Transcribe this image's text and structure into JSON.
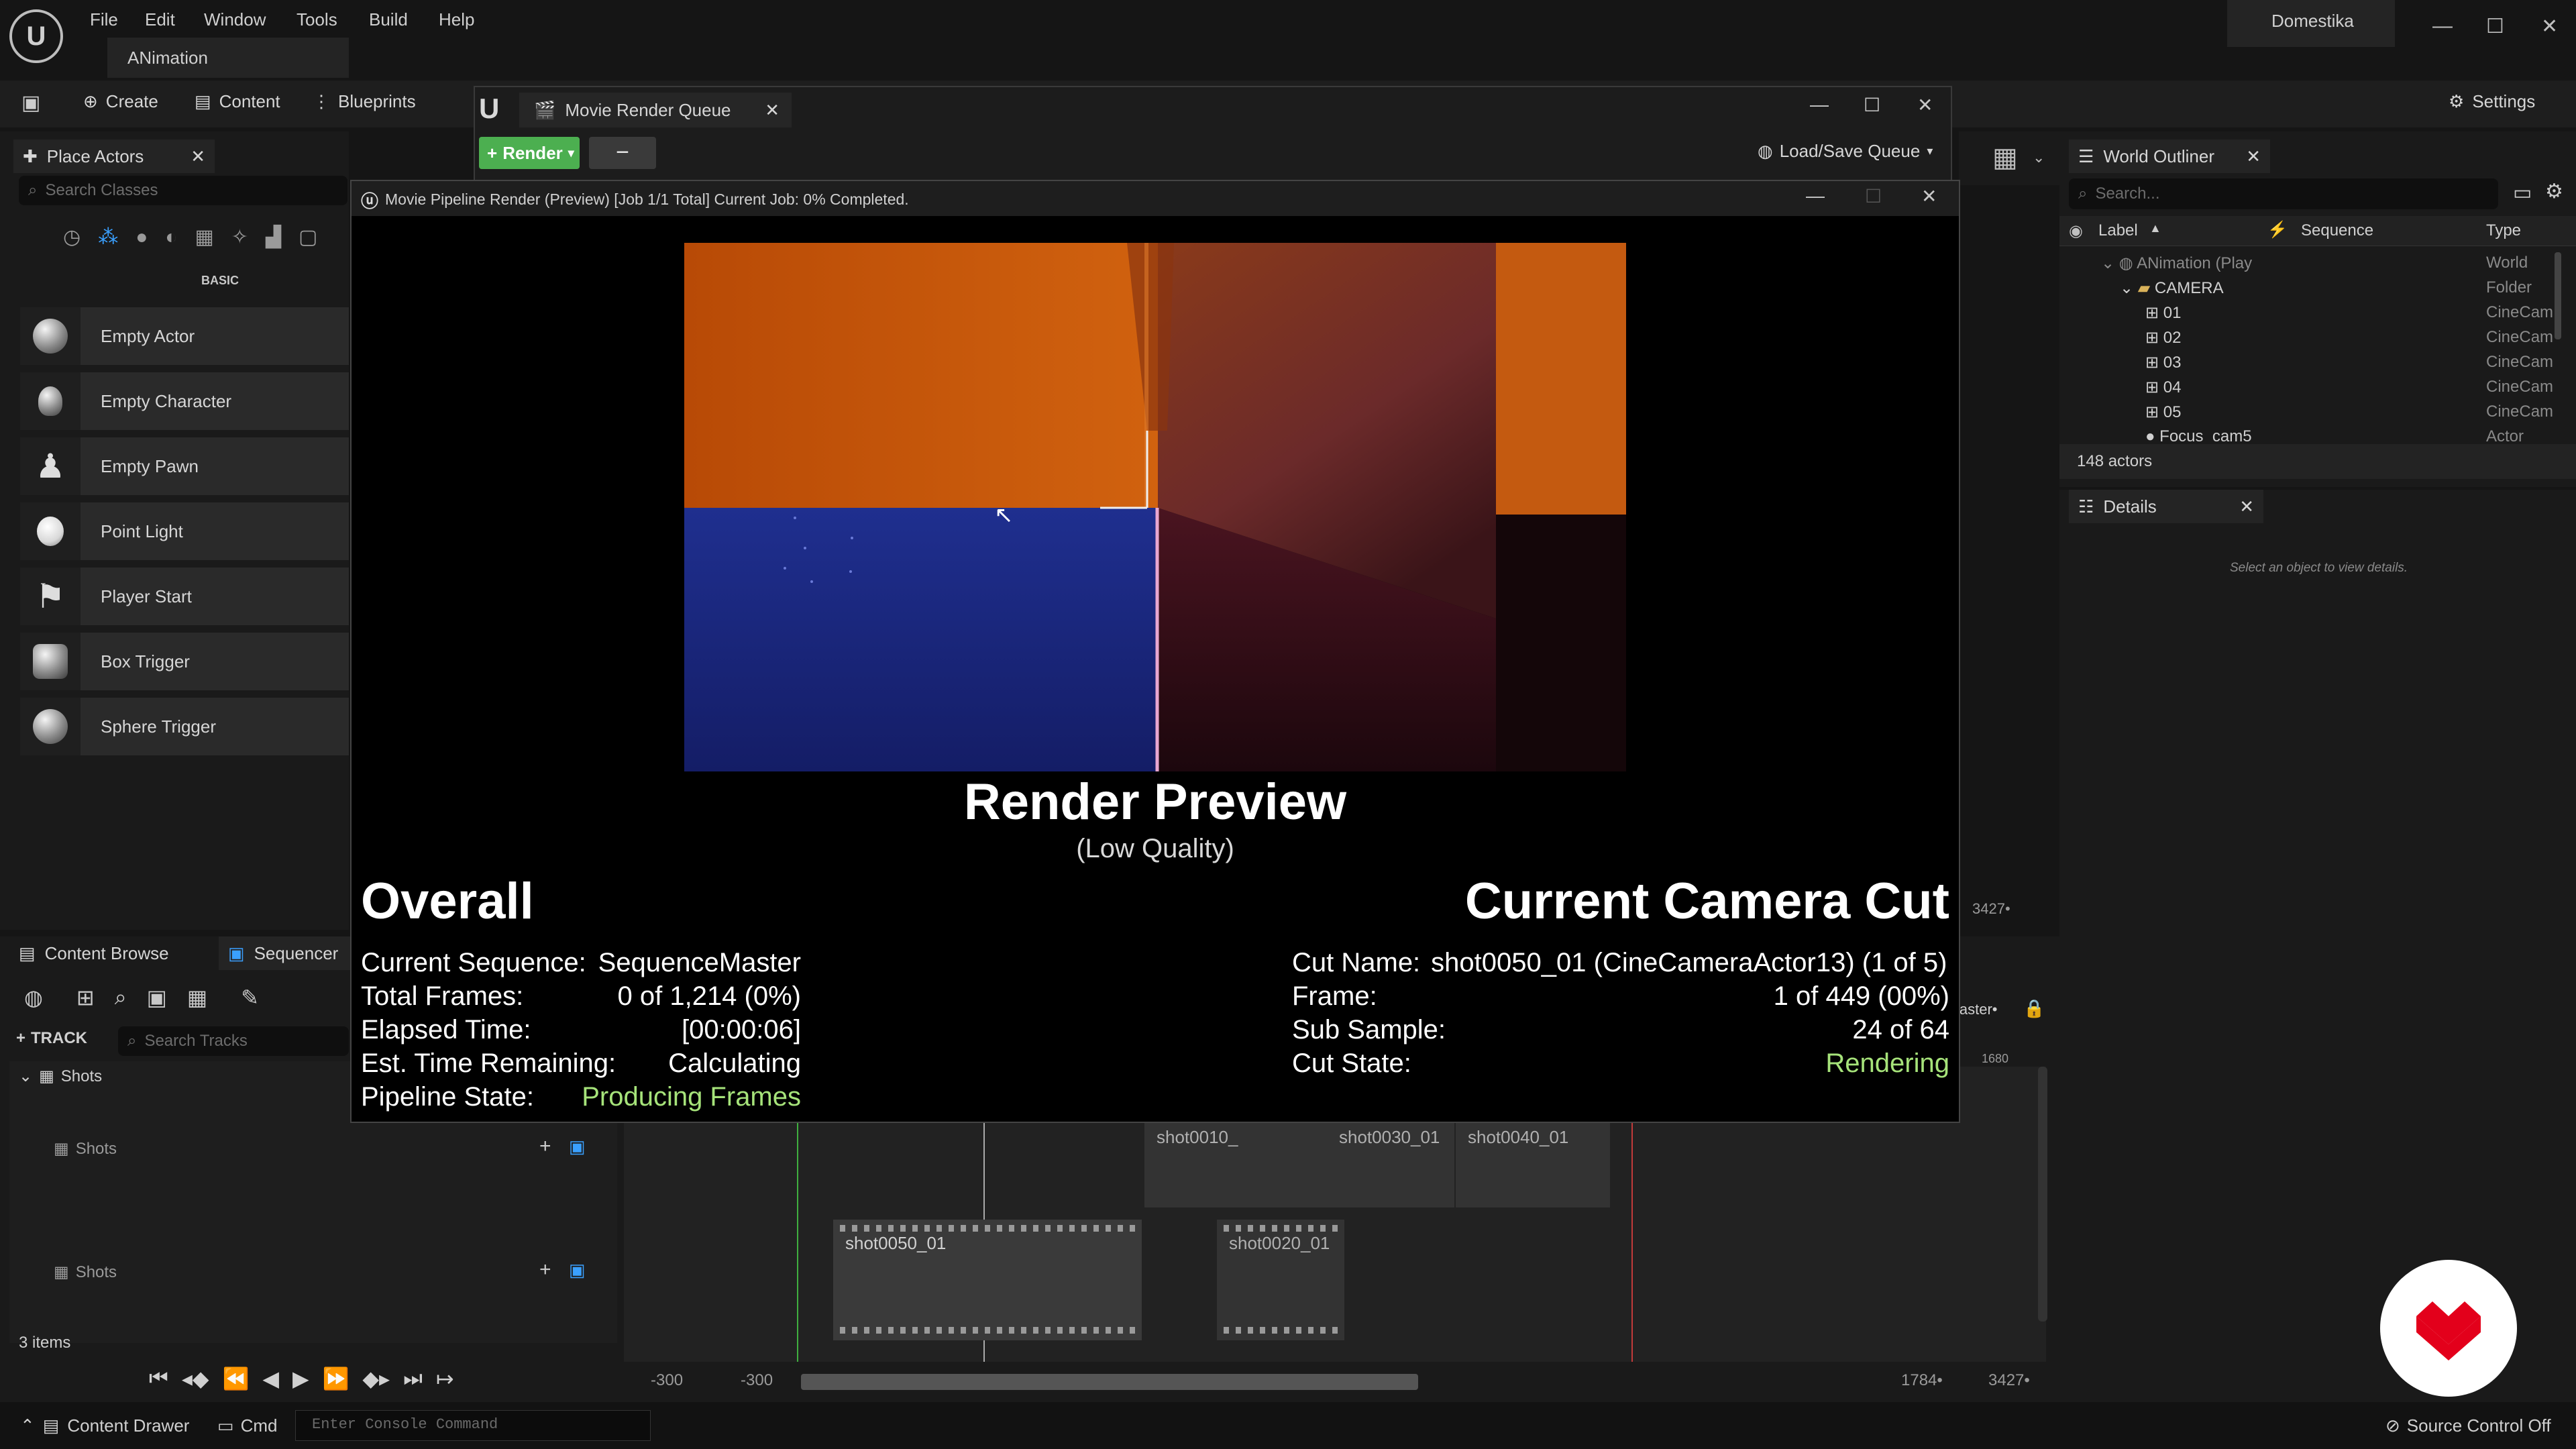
{
  "menubar": {
    "items": [
      "File",
      "Edit",
      "Window",
      "Tools",
      "Build",
      "Help"
    ],
    "project_tab": "ANimation",
    "app_title": "Domestika"
  },
  "toolbar": {
    "create": "Create",
    "content": "Content",
    "blueprints": "Blueprints",
    "settings": "Settings"
  },
  "place_actors": {
    "tab": "Place Actors",
    "search_placeholder": "Search Classes",
    "category": "BASIC",
    "items": [
      "Empty Actor",
      "Empty Character",
      "Empty Pawn",
      "Point Light",
      "Player Start",
      "Box Trigger",
      "Sphere Trigger"
    ]
  },
  "mrq": {
    "tab": "Movie Render Queue",
    "render_button": "Render",
    "load_save": "Load/Save Queue"
  },
  "preview": {
    "title": "Movie Pipeline Render (Preview) [Job 1/1 Total] Current Job: 0% Completed.",
    "heading": "Render Preview",
    "subheading": "(Low Quality)",
    "overall": {
      "title": "Overall",
      "rows": [
        {
          "label": "Current Sequence:",
          "value": "SequenceMaster"
        },
        {
          "label": "Total Frames:",
          "value": "0 of 1,214 (0%)"
        },
        {
          "label": "Elapsed Time:",
          "value": "[00:00:06]"
        },
        {
          "label": "Est. Time Remaining:",
          "value": "Calculating"
        },
        {
          "label": "Pipeline State:",
          "value": "Producing Frames"
        }
      ]
    },
    "camera_cut": {
      "title": "Current Camera Cut",
      "rows": [
        {
          "label": "Cut Name:",
          "value": "shot0050_01 (CineCameraActor13) (1 of 5)"
        },
        {
          "label": "Frame:",
          "value": "1 of 449 (00%)"
        },
        {
          "label": "Sub Sample:",
          "value": "24 of 64"
        },
        {
          "label": "Cut State:",
          "value": "Rendering"
        }
      ]
    }
  },
  "outliner": {
    "tab": "World Outliner",
    "search_placeholder": "Search...",
    "columns": {
      "label": "Label",
      "sequence": "Sequence",
      "type": "Type"
    },
    "rows": [
      {
        "label": "ANimation (Play",
        "type": "World"
      },
      {
        "label": "CAMERA",
        "type": "Folder"
      },
      {
        "label": "01",
        "type": "CineCam"
      },
      {
        "label": "02",
        "type": "CineCam"
      },
      {
        "label": "03",
        "type": "CineCam"
      },
      {
        "label": "04",
        "type": "CineCam"
      },
      {
        "label": "05",
        "type": "CineCam"
      }
    ],
    "partial_row": {
      "label": "Focus_cam5",
      "type": "Actor"
    },
    "count": "148 actors"
  },
  "details": {
    "tab": "Details",
    "empty_text": "Select an object to view details."
  },
  "sequencer": {
    "tab_content": "Content Browse",
    "tab_sequencer": "Sequencer",
    "track_button": "TRACK",
    "search_placeholder": "Search Tracks",
    "root_track": "Shots",
    "tracks": [
      "Shots",
      "Shots"
    ],
    "items_count": "3 items",
    "master_label": "laster•",
    "ruler_1680": "1680",
    "shots_top": [
      "shot0010_",
      "shot0030_01",
      "shot0040_01"
    ],
    "shots_bottom": [
      "shot0050_01",
      "shot0020_01"
    ],
    "range_start_a": "-300",
    "range_start_b": "-300",
    "range_end_a": "1784•",
    "range_end_b": "3427•",
    "range_top": "3427•"
  },
  "statusbar": {
    "content_drawer": "Content Drawer",
    "cmd": "Cmd",
    "console_placeholder": "Enter Console Command",
    "source_control": "Source Control Off"
  },
  "colors": {
    "accent_green": "#a6e37a",
    "render_button": "#4caf50",
    "brand_red": "#e3001b"
  }
}
